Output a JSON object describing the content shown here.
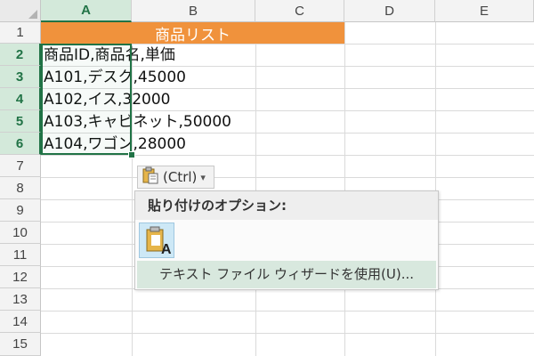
{
  "columns": [
    "A",
    "B",
    "C",
    "D",
    "E"
  ],
  "rows": [
    "1",
    "2",
    "3",
    "4",
    "5",
    "6",
    "7",
    "8",
    "9",
    "10",
    "11",
    "12",
    "13",
    "14",
    "15"
  ],
  "title_cell": "商品リスト",
  "cells": [
    "商品ID,商品名,単価",
    "A101,デスク,45000",
    "A102,イス,32000",
    "A103,キャビネット,50000",
    "A104,ワゴン,28000"
  ],
  "paste_tag": {
    "label": "(Ctrl)",
    "caret": "▾"
  },
  "paste_menu": {
    "header": "貼り付けのオプション:",
    "option_letter": "A",
    "wizard_label": "テキスト ファイル ウィザードを使用(U)..."
  },
  "colors": {
    "title_fill": "#f0923c",
    "selection": "#217346",
    "menu_hover": "#d8e8de"
  }
}
